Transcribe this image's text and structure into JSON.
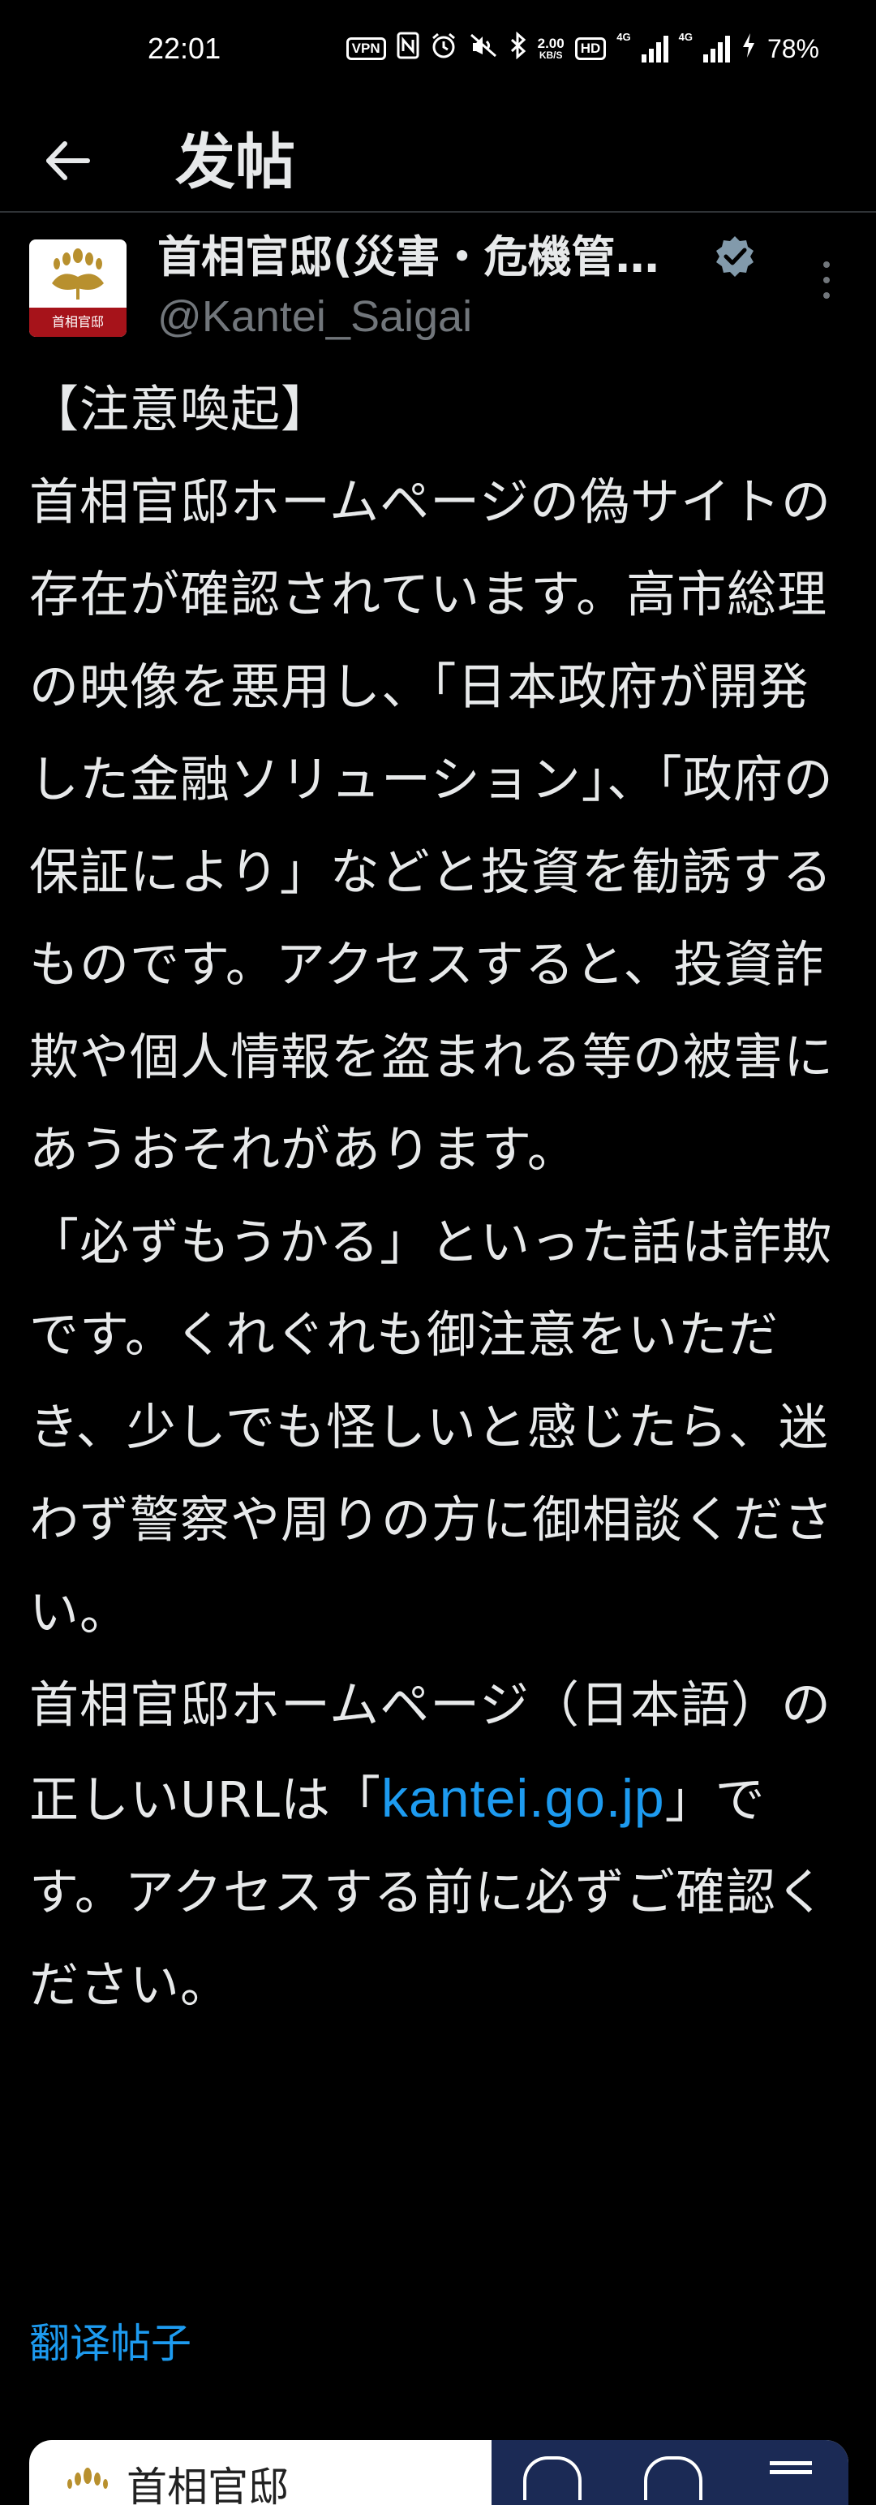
{
  "status_bar": {
    "time": "22:01",
    "vpn": "VPN",
    "speed_value": "2.00",
    "speed_unit": "KB/S",
    "hd": "HD",
    "net1": "4G",
    "net2": "4G",
    "battery": "78%"
  },
  "header": {
    "title": "发帖"
  },
  "author": {
    "name": "首相官邸(災害・危機管…",
    "handle": "@Kantei_Saigai",
    "avatar_label": "首相官邸"
  },
  "post": {
    "segments": [
      "【注意喚起】\n首相官邸ホームページの偽サイトの存在が確認されています。高市総理の映像を悪用し、「日本政府が開発した金融ソリューション」、「政府の保証により」などと投資を勧誘するものです。アクセスすると、投資詐欺や個人情報を盗まれる等の被害にあうおそれがあります。\n「必ずもうかる」といった話は詐欺です。くれぐれも御注意をいただき、少しでも怪しいと感じたら、迷わず警察や周りの方に御相談ください。\n首相官邸ホームページ（日本語）の正しいURLは「",
      "」です。アクセスする前に必ずご確認ください。"
    ],
    "link_text": "kantei.go.jp"
  },
  "translate_label": "翻译帖子",
  "link_card": {
    "logo_text": "首相官邸"
  },
  "colors": {
    "background": "#000000",
    "text": "#e7e9ea",
    "secondary": "#71767b",
    "link": "#1d9bf0",
    "divider": "#2f3336"
  }
}
